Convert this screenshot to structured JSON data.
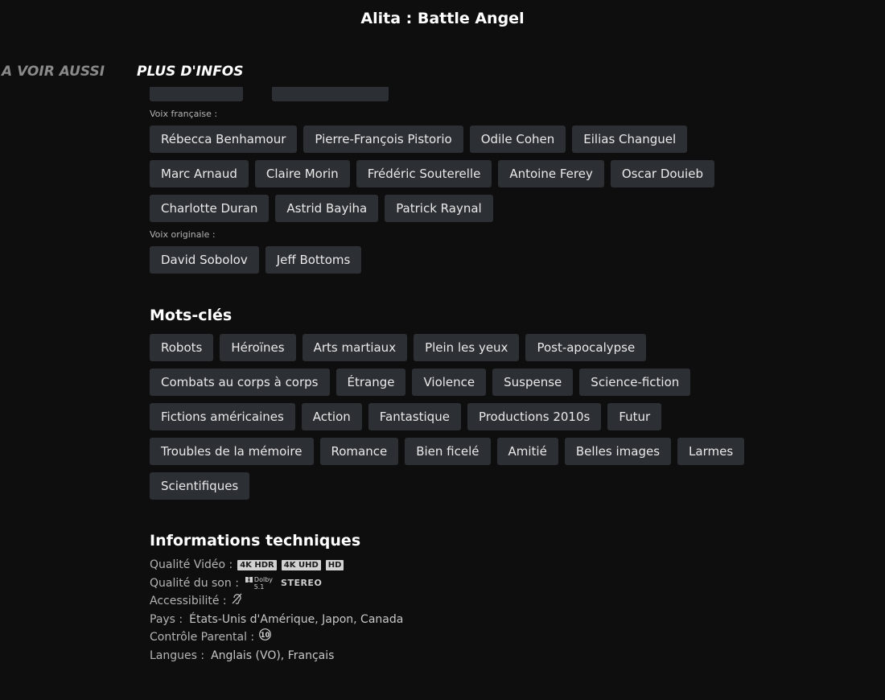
{
  "header": {
    "title": "Alita : Battle Angel"
  },
  "tabs": [
    {
      "label": "A VOIR AUSSI"
    },
    {
      "label": "PLUS D'INFOS"
    }
  ],
  "voix_francaise": {
    "label": "Voix française :",
    "people": [
      "Rébecca Benhamour",
      "Pierre-François Pistorio",
      "Odile Cohen",
      "Eilias Changuel",
      "Marc Arnaud",
      "Claire Morin",
      "Frédéric Souterelle",
      "Antoine Ferey",
      "Oscar Douieb",
      "Charlotte Duran",
      "Astrid Bayiha",
      "Patrick Raynal"
    ]
  },
  "voix_originale": {
    "label": "Voix originale :",
    "people": [
      "David Sobolov",
      "Jeff Bottoms"
    ]
  },
  "mots_cles": {
    "heading": "Mots-clés",
    "tags": [
      "Robots",
      "Héroïnes",
      "Arts martiaux",
      "Plein les yeux",
      "Post-apocalypse",
      "Combats au corps à corps",
      "Étrange",
      "Violence",
      "Suspense",
      "Science-fiction",
      "Fictions américaines",
      "Action",
      "Fantastique",
      "Productions 2010s",
      "Futur",
      "Troubles de la mémoire",
      "Romance",
      "Bien ficelé",
      "Amitié",
      "Belles images",
      "Larmes",
      "Scientifiques"
    ]
  },
  "tech": {
    "heading": "Informations techniques",
    "video_label": "Qualité Vidéo :",
    "video_badges": [
      "4K HDR",
      "4K UHD",
      "HD"
    ],
    "son_label": "Qualité du son :",
    "dolby_text": "Dolby",
    "dolby_sub": "5.1",
    "stereo": "STEREO",
    "access_label": "Accessibilité :",
    "access_icon": "hearing-impaired-icon",
    "pays_label": "Pays :",
    "pays_value": "États-Unis d'Amérique, Japon, Canada",
    "controle_label": "Contrôle Parental :",
    "controle_icon": "rating-10-icon",
    "rating_text": "10",
    "langues_label": "Langues :",
    "langues_value": "Anglais (VO), Français"
  }
}
